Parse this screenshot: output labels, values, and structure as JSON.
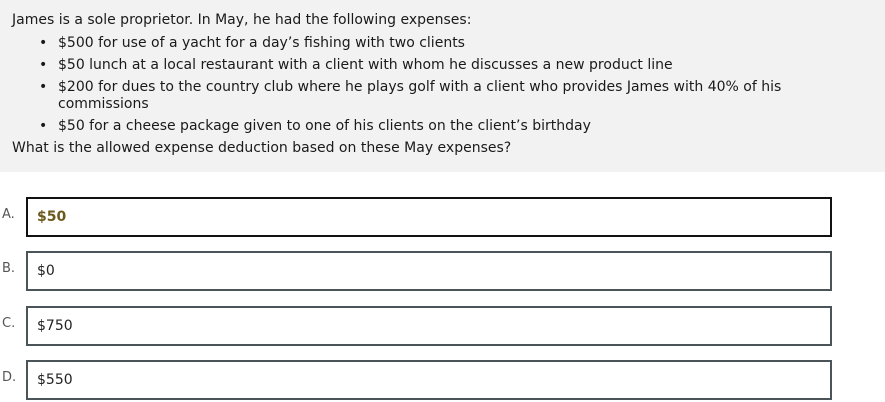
{
  "question": {
    "intro": "James is a sole proprietor. In May, he had the following expenses:",
    "expenses": [
      "$500 for use of a yacht for a day’s fishing with two clients",
      "$50 lunch at a local restaurant with a client with whom he discusses a new product line",
      "$200 for dues to the country club where he plays golf with a client who provides James with 40% of his commissions",
      "$50 for a cheese package given to one of his clients on the client’s birthday"
    ],
    "prompt": "What is the allowed expense deduction based on these May expenses?"
  },
  "options": [
    {
      "letter": "A.",
      "text": "$50",
      "selected": true
    },
    {
      "letter": "B.",
      "text": "$0",
      "selected": false
    },
    {
      "letter": "C.",
      "text": "$750",
      "selected": false
    },
    {
      "letter": "D.",
      "text": "$550",
      "selected": false
    }
  ],
  "colors": {
    "question_bg": "#f2f2f2",
    "option_border": "#4a5459",
    "selected_text": "#6b5a1e"
  }
}
